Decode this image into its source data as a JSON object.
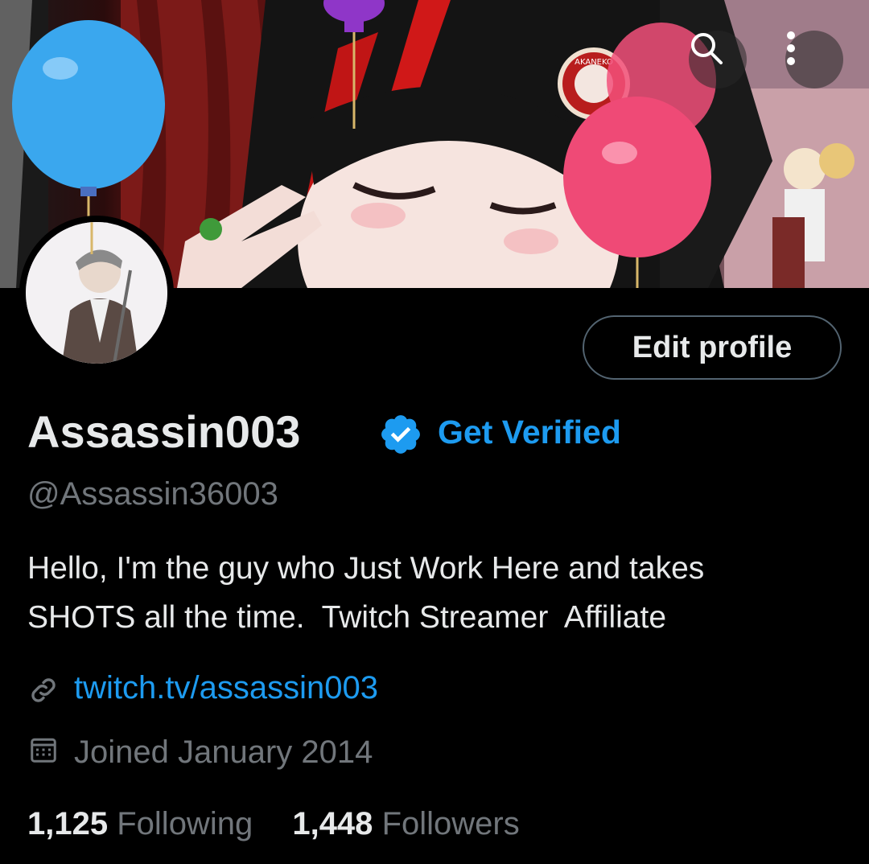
{
  "header": {
    "icons": [
      "search-icon",
      "more-vertical-icon"
    ]
  },
  "banner": {
    "badge_text": "AKANEKO"
  },
  "profile": {
    "display_name": "Assassin003",
    "verified_icon": "verified-badge-icon",
    "get_verified_label": "Get Verified",
    "handle": "@Assassin36003",
    "bio": "Hello, I'm the guy who Just Work Here and takes\nSHOTS all the time.  Twitch Streamer  Affiliate",
    "link": "twitch.tv/assassin003",
    "joined": "Joined January 2014",
    "following_count": "1,125",
    "following_label": "Following",
    "followers_count": "1,448",
    "followers_label": "Followers",
    "edit_profile_label": "Edit profile"
  },
  "colors": {
    "background": "#000000",
    "accent": "#1d9bf0",
    "secondary_text": "#71767b",
    "primary_text": "#e7e9ea"
  }
}
